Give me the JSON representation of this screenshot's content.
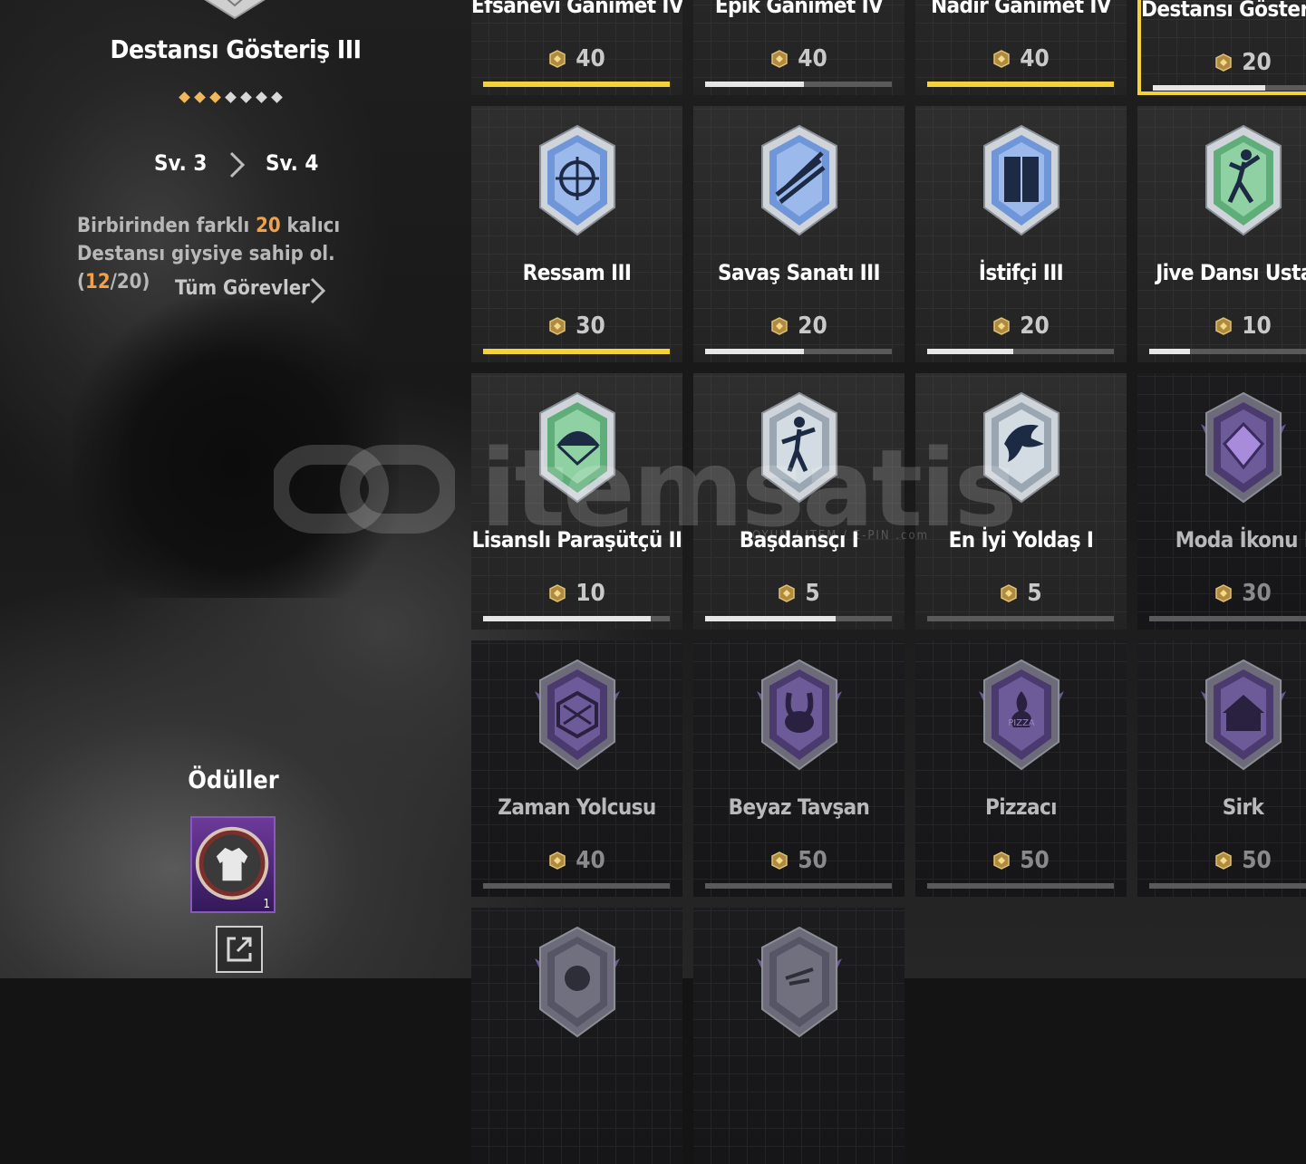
{
  "left_panel": {
    "title": "Destansı Gösteriş III",
    "stars_filled": 3,
    "stars_total": 7,
    "level_from": "Sv. 3",
    "level_to": "Sv. 4",
    "description_before": "Birbirinden farklı ",
    "description_target": "20",
    "description_after": " kalıcı Destansı giysiye sahip ol. (",
    "description_current": "12",
    "description_total": "/20)",
    "all_tasks_label": "Tüm Görevler",
    "rewards_title": "Ödüller",
    "reward_count": "1",
    "reward_icon": "jacket-icon",
    "share_icon": "share-icon"
  },
  "colors": {
    "accent_gold": "#f3d23a",
    "highlight_orange": "#f0a14a"
  },
  "watermark": {
    "text": "itemsatis",
    "subtext": "OYUN / ITEM / E-PIN",
    "subtext2": ".com"
  },
  "achievements": [
    {
      "name": "Efsanevi Ganimet IV",
      "points": "40",
      "progress": 1.0,
      "style": "gold",
      "icon": "loot-icon"
    },
    {
      "name": "Epik Ganimet IV",
      "points": "40",
      "progress": 0.53,
      "style": "normal",
      "icon": "loot-icon"
    },
    {
      "name": "Nadir Ganimet IV",
      "points": "40",
      "progress": 1.0,
      "style": "gold",
      "icon": "loot-icon"
    },
    {
      "name": "Destansı Gösteriş III",
      "points": "20",
      "progress": 0.6,
      "style": "selected",
      "icon": "outfit-icon"
    },
    {
      "name": "Ressam III",
      "points": "30",
      "progress": 1.0,
      "style": "gold",
      "icon": "spray-crosshair-icon"
    },
    {
      "name": "Savaş Sanatı III",
      "points": "20",
      "progress": 0.53,
      "style": "normal",
      "icon": "rifles-icon"
    },
    {
      "name": "İstifçi III",
      "points": "20",
      "progress": 0.46,
      "style": "normal",
      "icon": "locker-icon"
    },
    {
      "name": "Jive Dansı Ustası",
      "points": "10",
      "progress": 0.22,
      "style": "normal",
      "icon": "dancer-icon"
    },
    {
      "name": "Lisanslı Paraşütçü II",
      "points": "10",
      "progress": 0.9,
      "style": "normal",
      "icon": "parachute-icon"
    },
    {
      "name": "Başdansçı I",
      "points": "5",
      "progress": 0.7,
      "style": "normal",
      "icon": "dance-icon"
    },
    {
      "name": "En İyi Yoldaş I",
      "points": "5",
      "progress": 0.0,
      "style": "normal",
      "icon": "eagle-icon"
    },
    {
      "name": "Moda İkonu I",
      "points": "30",
      "progress": 0.0,
      "style": "locked",
      "icon": "gem-icon"
    },
    {
      "name": "Zaman Yolcusu",
      "points": "40",
      "progress": 0.0,
      "style": "locked",
      "icon": "hourglass-icon"
    },
    {
      "name": "Beyaz Tavşan",
      "points": "50",
      "progress": 0.0,
      "style": "locked",
      "icon": "rabbit-icon"
    },
    {
      "name": "Pizzacı",
      "points": "50",
      "progress": 0.0,
      "style": "locked",
      "icon": "pizza-icon"
    },
    {
      "name": "Sirk",
      "points": "50",
      "progress": 0.0,
      "style": "locked",
      "icon": "circus-tent-icon"
    },
    {
      "name": "",
      "points": "",
      "progress": 0.0,
      "style": "locked",
      "icon": "skull-icon"
    },
    {
      "name": "",
      "points": "",
      "progress": 0.0,
      "style": "locked",
      "icon": "ninja-icon"
    }
  ],
  "pizza_label": "PIZZA"
}
